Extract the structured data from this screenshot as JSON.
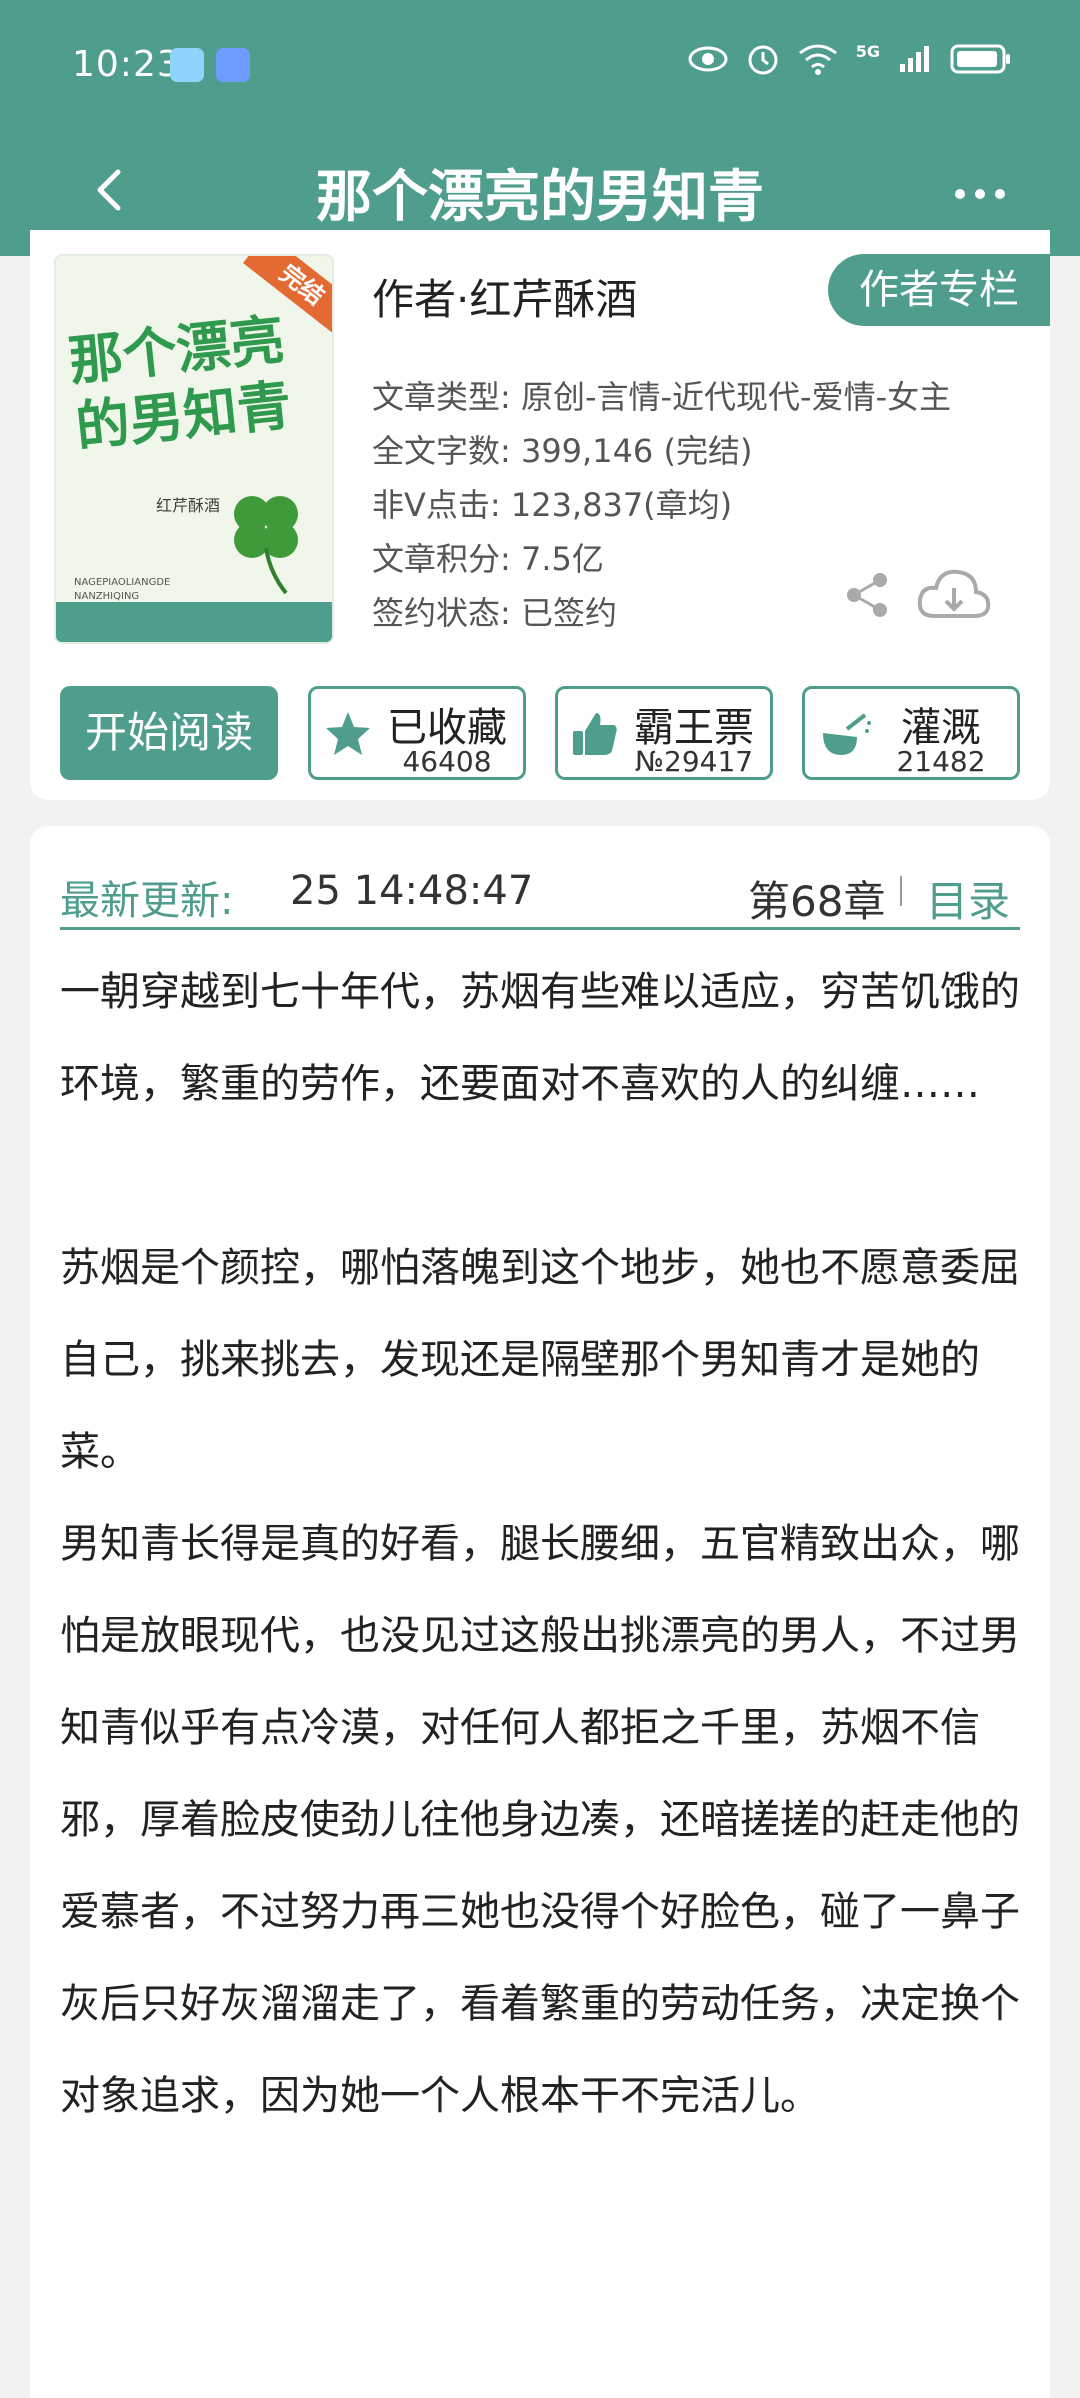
{
  "status": {
    "time": "10:23",
    "network": "5G"
  },
  "header": {
    "title": "那个漂亮的男知青"
  },
  "book": {
    "cover_title": "那个漂亮的男知青",
    "cover_author": "红芹酥酒",
    "cover_pinyin": "NAGEPIAOLIANGDE NANZHIQING",
    "cover_badge": "完结",
    "author_line": "作者·红芹酥酒",
    "author_column_label": "作者专栏",
    "meta": {
      "type": "文章类型: 原创-言情-近代现代-爱情-女主",
      "word_count": "全文字数: 399,146 (完结)",
      "clicks": "非Ⅴ点击: 123,837(章均)",
      "score": "文章积分: 7.5亿",
      "contract": "签约状态: 已签约"
    }
  },
  "actions": {
    "read_label": "开始阅读",
    "favorite": {
      "label": "已收藏",
      "count": "46408"
    },
    "bawang": {
      "label": "霸王票",
      "count": "№29417"
    },
    "water": {
      "label": "灌溉",
      "count": "21482"
    }
  },
  "update": {
    "label": "最新更新:",
    "time": "25 14:48:47",
    "chapter": "第68章",
    "toc_label": "目录"
  },
  "synopsis": [
    "一朝穿越到七十年代，苏烟有些难以适应，穷苦饥饿的环境，繁重的劳作，还要面对不喜欢的人的纠缠……",
    "",
    "苏烟是个颜控，哪怕落魄到这个地步，她也不愿意委屈自己，挑来挑去，发现还是隔壁那个男知青才是她的菜。",
    "男知青长得是真的好看，腿长腰细，五官精致出众，哪怕是放眼现代，也没见过这般出挑漂亮的男人，不过男知青似乎有点冷漠，对任何人都拒之千里，苏烟不信邪，厚着脸皮使劲儿往他身边凑，还暗搓搓的赶走他的爱慕者，不过努力再三她也没得个好脸色，碰了一鼻子灰后只好灰溜溜走了，看着繁重的劳动任务，决定换个对象追求，因为她一个人根本干不完活儿。"
  ],
  "colors": {
    "brand": "#4f9d8c",
    "badge": "#e46a33"
  }
}
